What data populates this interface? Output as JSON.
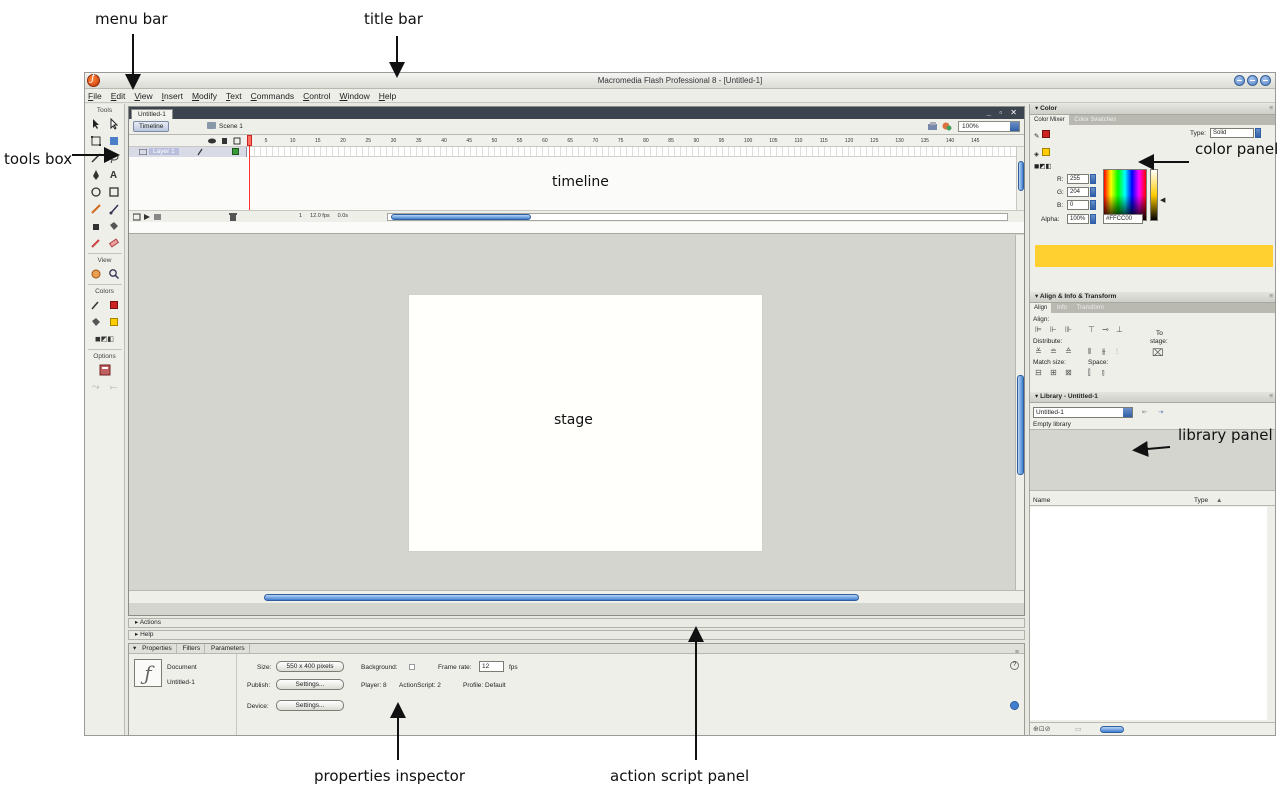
{
  "annotations": {
    "menu_bar": "menu bar",
    "title_bar": "title bar",
    "tools_box": "tools box",
    "color_panel": "color panel",
    "library_panel": "library panel",
    "properties_inspector": "properties inspector",
    "action_script_panel": "action script panel"
  },
  "window": {
    "title": "Macromedia Flash Professional 8 - [Untitled-1]"
  },
  "menu": [
    "File",
    "Edit",
    "View",
    "Insert",
    "Modify",
    "Text",
    "Commands",
    "Control",
    "Window",
    "Help"
  ],
  "tools": {
    "title": "Tools",
    "view_label": "View",
    "colors_label": "Colors",
    "options_label": "Options"
  },
  "document": {
    "tab": "Untitled-1",
    "window_controls": "_ ̅ X",
    "timeline_button": "Timeline",
    "scene": "Scene 1",
    "zoom": "100%"
  },
  "timeline": {
    "label": "timeline",
    "layer_name": "Layer 1",
    "frame_numbers": [
      "1",
      "5",
      "10",
      "15",
      "20",
      "25",
      "30",
      "35",
      "40",
      "45",
      "50",
      "55",
      "60",
      "65",
      "70",
      "75",
      "80",
      "85",
      "90",
      "95",
      "100",
      "105",
      "110",
      "115",
      "120",
      "125",
      "130",
      "135",
      "140",
      "145"
    ],
    "current_frame": "1",
    "frame_rate": "12.0 fps",
    "elapsed": "0.0s"
  },
  "stage": {
    "label": "stage"
  },
  "panels": {
    "actions": "Actions",
    "help": "Help"
  },
  "properties": {
    "tabs": [
      "Properties",
      "Filters",
      "Parameters"
    ],
    "doc_type": "Document",
    "doc_name": "Untitled-1",
    "size_label": "Size:",
    "size_value": "550 x 400 pixels",
    "background_label": "Background:",
    "frame_rate_label": "Frame rate:",
    "frame_rate_value": "12",
    "fps": "fps",
    "publish_label": "Publish:",
    "settings_button": "Settings...",
    "player": "Player: 8",
    "actionscript": "ActionScript: 2",
    "profile": "Profile: Default",
    "device_label": "Device:",
    "device_button": "Settings..."
  },
  "color_panel": {
    "title": "Color",
    "tabs": [
      "Color Mixer",
      "Color Swatches"
    ],
    "type_label": "Type:",
    "type_value": "Solid",
    "r_label": "R:",
    "r_value": "255",
    "g_label": "G:",
    "g_value": "204",
    "b_label": "B:",
    "b_value": "0",
    "alpha_label": "Alpha:",
    "alpha_value": "100%",
    "hex_value": "#FFCC00",
    "preview_color": "#FFCC00"
  },
  "align_panel": {
    "title": "Align & Info & Transform",
    "tabs": [
      "Align",
      "Info",
      "Transform"
    ],
    "align_label": "Align:",
    "distribute_label": "Distribute:",
    "match_size_label": "Match size:",
    "space_label": "Space:",
    "to_stage_label_1": "To",
    "to_stage_label_2": "stage:"
  },
  "library_panel": {
    "title": "Library - Untitled-1",
    "dropdown": "Untitled-1",
    "empty_text": "Empty library",
    "col_name": "Name",
    "col_type": "Type"
  }
}
